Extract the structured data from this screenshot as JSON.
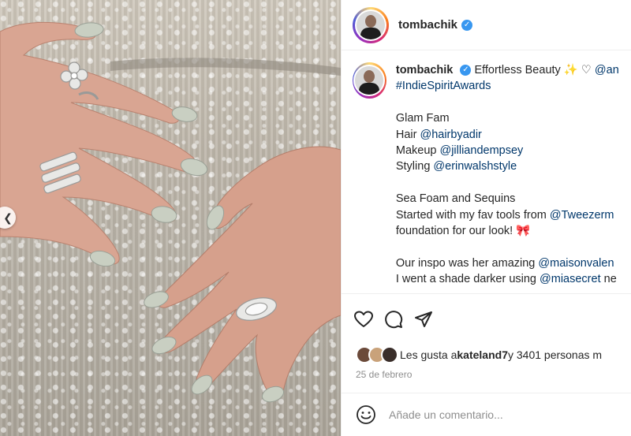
{
  "post": {
    "username": "tombachik",
    "caption_lines": [
      {
        "parts": [
          {
            "t": "Effortless Beauty ✨ ♡ ",
            "k": "text"
          },
          {
            "t": "@an",
            "k": "link"
          }
        ]
      },
      {
        "parts": [
          {
            "t": "#IndieSpiritAwards",
            "k": "link"
          }
        ]
      },
      {
        "parts": []
      },
      {
        "parts": [
          {
            "t": "Glam Fam",
            "k": "text"
          }
        ]
      },
      {
        "parts": [
          {
            "t": "Hair ",
            "k": "text"
          },
          {
            "t": "@hairbyadir",
            "k": "link"
          }
        ]
      },
      {
        "parts": [
          {
            "t": "Makeup ",
            "k": "text"
          },
          {
            "t": "@jilliandempsey",
            "k": "link"
          }
        ]
      },
      {
        "parts": [
          {
            "t": "Styling ",
            "k": "text"
          },
          {
            "t": "@erinwalshstyle",
            "k": "link"
          }
        ]
      },
      {
        "parts": []
      },
      {
        "parts": [
          {
            "t": "Sea Foam and Sequins",
            "k": "text"
          }
        ]
      },
      {
        "parts": [
          {
            "t": "Started with my fav tools from ",
            "k": "text"
          },
          {
            "t": "@Tweezerm",
            "k": "link"
          }
        ]
      },
      {
        "parts": [
          {
            "t": "foundation for our look! 🎀",
            "k": "text"
          }
        ]
      },
      {
        "parts": []
      },
      {
        "parts": [
          {
            "t": "Our inspo was her amazing ",
            "k": "text"
          },
          {
            "t": "@maisonvalen",
            "k": "link"
          }
        ]
      },
      {
        "parts": [
          {
            "t": "I went a shade darker using ",
            "k": "text"
          },
          {
            "t": "@miasecret",
            "k": "link"
          },
          {
            "t": " ne",
            "k": "text"
          }
        ]
      }
    ],
    "likes": {
      "prefix": "Les gusta a ",
      "user": "kateland7",
      "suffix": " y 3401 personas m"
    },
    "date": "25 de febrero",
    "comment": {
      "placeholder": "Añade un comentario..."
    }
  },
  "icons": {
    "verified": "verified-badge-icon",
    "like": "heart-icon",
    "comment": "comment-bubble-icon",
    "share": "paper-plane-icon",
    "emoji": "emoji-smile-icon",
    "carousel_prev": "chevron-left-icon"
  },
  "colors": {
    "link": "#00376b",
    "verified": "#3897f0",
    "muted": "#8e8e8e",
    "text": "#262626"
  }
}
